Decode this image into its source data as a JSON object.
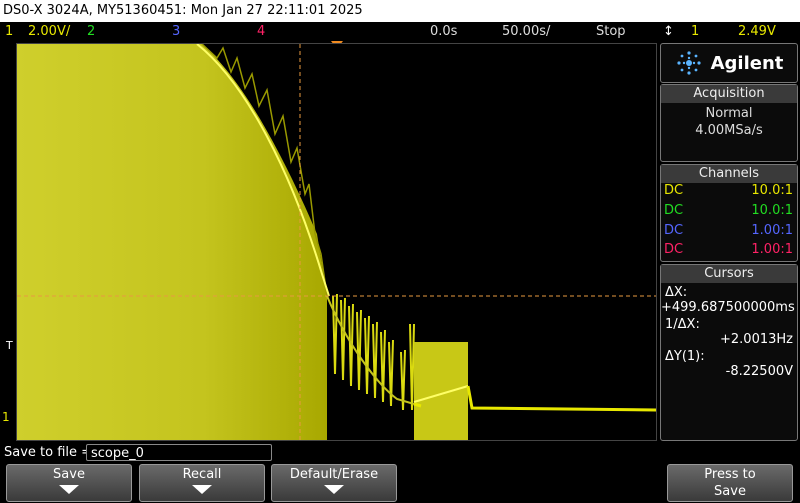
{
  "title": "DS0-X 3024A, MY51360451: Mon Jan 27 22:11:01 2025",
  "status": {
    "ch1_num": "1",
    "ch1_scale": "2.00V/",
    "ch2_num": "2",
    "ch3_num": "3",
    "ch4_num": "4",
    "time_pos": "0.0s",
    "time_scale": "50.00s/",
    "run_state": "Stop",
    "trig_icon": "↕",
    "trig_ch": "1",
    "trig_level": "2.49V"
  },
  "colors": {
    "ch1": "#e8e800",
    "ch2": "#22dd22",
    "ch3": "#5566ff",
    "ch4": "#ff2266",
    "cursor": "#e89a40"
  },
  "brand": {
    "name": "Agilent"
  },
  "acquisition": {
    "header": "Acquisition",
    "mode": "Normal",
    "rate": "4.00MSa/s"
  },
  "channels": {
    "header": "Channels",
    "rows": [
      {
        "coupling": "DC",
        "probe": "10.0:1"
      },
      {
        "coupling": "DC",
        "probe": "10.0:1"
      },
      {
        "coupling": "DC",
        "probe": "1.00:1"
      },
      {
        "coupling": "DC",
        "probe": "1.00:1"
      }
    ]
  },
  "cursors": {
    "header": "Cursors",
    "dx_label": "ΔX:",
    "dx_value": "+499.687500000ms",
    "inv_label": "1/ΔX:",
    "inv_value": "+2.0013Hz",
    "dy_label": "ΔY(1):",
    "dy_value": "-8.22500V"
  },
  "markers": {
    "trigger_marker": "T",
    "ch1_ground": "1"
  },
  "save": {
    "label": "Save to file =",
    "value": "scope_0"
  },
  "softkeys": {
    "save": "Save",
    "recall": "Recall",
    "default": "Default/Erase",
    "press_line1": "Press to",
    "press_line2": "Save"
  }
}
